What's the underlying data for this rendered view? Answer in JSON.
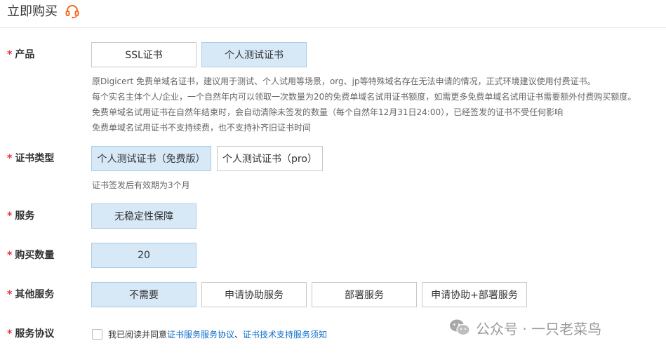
{
  "header": {
    "title": "立即购买",
    "icon": "headset-icon",
    "icon_color": "#f26b22"
  },
  "product": {
    "label": "产品",
    "required_mark": "*",
    "options": [
      "SSL证书",
      "个人测试证书"
    ],
    "selected": "个人测试证书",
    "notes": [
      "原Digicert 免费单域名证书，建议用于测试、个人试用等场景，org、jp等特殊域名存在无法申请的情况，正式环境建议使用付费证书。",
      "每个实名主体个人/企业，一个自然年内可以领取一次数量为20的免费单域名试用证书额度，如需更多免费单域名试用证书需要额外付费购买额度。",
      "免费单域名试用证书在自然年结束时，会自动清除未签发的数量（每个自然年12月31日24:00），已经签发的证书不受任何影响",
      "免费单域名试用证书不支持续费，也不支持补齐旧证书时间"
    ]
  },
  "cert_type": {
    "label": "证书类型",
    "required_mark": "*",
    "options": [
      "个人测试证书（免费版）",
      "个人测试证书（pro）"
    ],
    "selected": "个人测试证书（免费版）",
    "note": "证书签发后有效期为3个月"
  },
  "service": {
    "label": "服务",
    "required_mark": "*",
    "options": [
      "无稳定性保障"
    ],
    "selected": "无稳定性保障"
  },
  "quantity": {
    "label": "购买数量",
    "required_mark": "*",
    "value": "20"
  },
  "other_services": {
    "label": "其他服务",
    "required_mark": "*",
    "options": [
      "不需要",
      "申请协助服务",
      "部署服务",
      "申请协助+部署服务"
    ],
    "selected": "不需要"
  },
  "agreement": {
    "label": "服务协议",
    "required_mark": "*",
    "prefix": "我已阅读并同意",
    "link1": "证书服务服务协议",
    "separator": "、",
    "link2": "证书技术支持服务须知",
    "checked": false
  },
  "watermark": {
    "text": "公众号 · 一只老菜鸟",
    "icon": "wechat-icon"
  },
  "colors": {
    "selected_bg": "#d7e8f7",
    "required": "#e4393c",
    "link": "#0a6ec8"
  }
}
